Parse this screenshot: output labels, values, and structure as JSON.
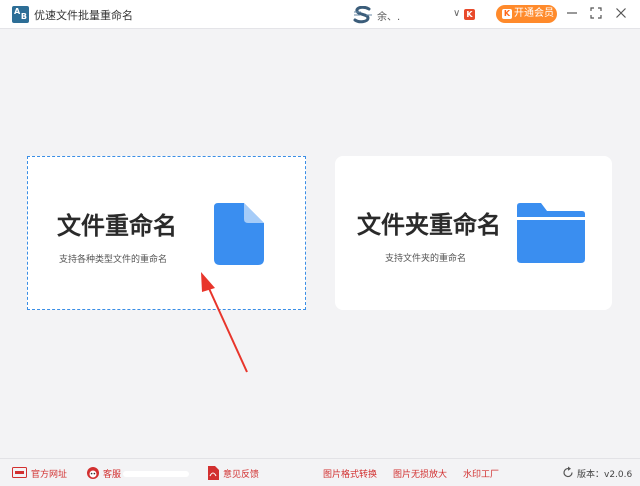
{
  "window": {
    "title": "优速文件批量重命名",
    "app_icon_a": "A",
    "app_icon_b": "B",
    "user_name": "余、.",
    "user_caret": "∨",
    "user_badge": "K",
    "vip_button": "开通会员",
    "vip_icon": "K"
  },
  "cards": {
    "file": {
      "title": "文件重命名",
      "description": "支持各种类型文件的重命名",
      "icon": "file-icon",
      "selected": true
    },
    "folder": {
      "title": "文件夹重命名",
      "description": "支持文件夹的重命名",
      "icon": "folder-icon",
      "selected": false
    }
  },
  "footer": {
    "website": "官方网址",
    "service": "客服",
    "feedback": "意见反馈",
    "tools": [
      "图片格式转换",
      "图片无损放大",
      "水印工厂"
    ],
    "version": "版本：v2.0.6"
  },
  "colors": {
    "accent": "#3a8ee6",
    "icon_blue": "#3a8ef0",
    "vip_orange": "#ff8a2b",
    "footer_red": "#d23030",
    "arrow_red": "#e8352b"
  }
}
